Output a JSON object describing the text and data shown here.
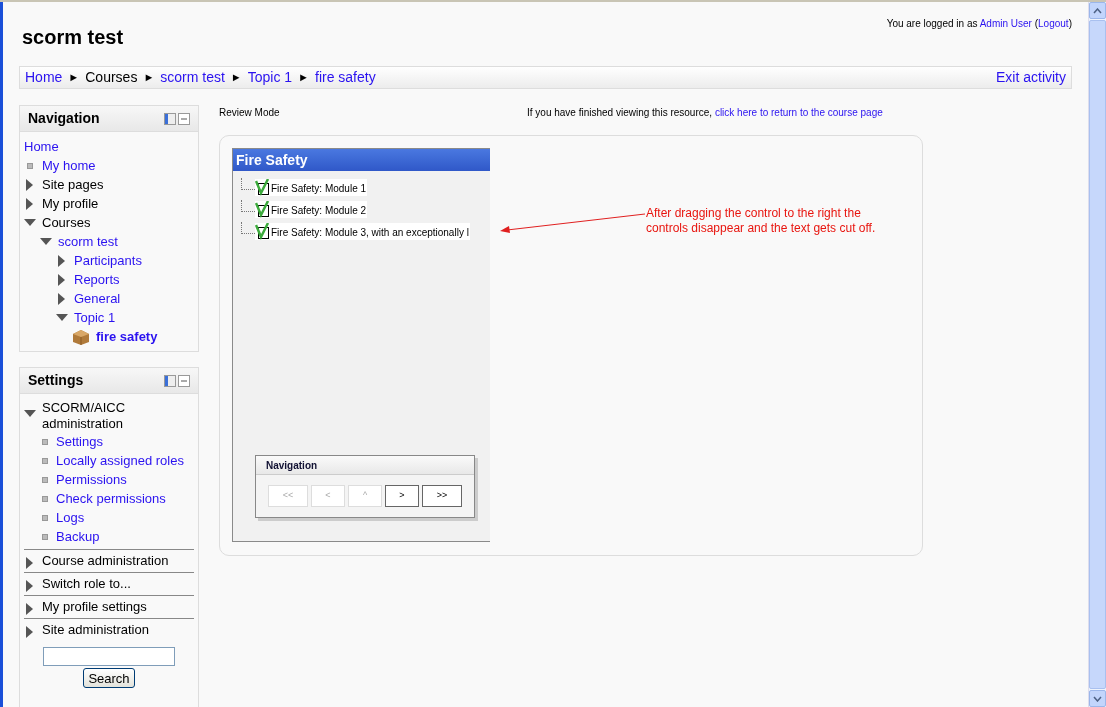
{
  "header": {
    "title": "scorm test",
    "login_text": "You are logged in as",
    "user": "Admin User",
    "logout_open": "(",
    "logout": "Logout",
    "logout_close": ")"
  },
  "breadcrumb": {
    "separator": "►",
    "items": [
      {
        "label": "Home",
        "link": true
      },
      {
        "label": "Courses",
        "link": false
      },
      {
        "label": "scorm test",
        "link": true
      },
      {
        "label": "Topic 1",
        "link": true
      },
      {
        "label": "fire safety",
        "link": true
      }
    ],
    "exit": "Exit activity"
  },
  "navigation": {
    "title": "Navigation",
    "items": [
      {
        "label": "Home",
        "kind": "root",
        "link": true
      },
      {
        "label": "My home",
        "kind": "leaf",
        "link": true
      },
      {
        "label": "Site pages",
        "kind": "branch",
        "link": false,
        "expanded": false
      },
      {
        "label": "My profile",
        "kind": "branch",
        "link": false,
        "expanded": false
      },
      {
        "label": "Courses",
        "kind": "branch",
        "link": false,
        "expanded": true,
        "children": [
          {
            "label": "scorm test",
            "kind": "branch",
            "link": true,
            "expanded": true,
            "children": [
              {
                "label": "Participants",
                "kind": "branch",
                "link": true,
                "expanded": false
              },
              {
                "label": "Reports",
                "kind": "branch",
                "link": true,
                "expanded": false
              },
              {
                "label": "General",
                "kind": "branch",
                "link": true,
                "expanded": false
              },
              {
                "label": "Topic 1",
                "kind": "branch",
                "link": true,
                "expanded": true,
                "children": [
                  {
                    "label": "fire safety",
                    "kind": "activity",
                    "link": true
                  }
                ]
              }
            ]
          }
        ]
      }
    ]
  },
  "settings": {
    "title": "Settings",
    "sections": [
      {
        "label": "SCORM/AICC administration",
        "expanded": true,
        "children": [
          {
            "label": "Settings"
          },
          {
            "label": "Locally assigned roles"
          },
          {
            "label": "Permissions"
          },
          {
            "label": "Check permissions"
          },
          {
            "label": "Logs"
          },
          {
            "label": "Backup"
          }
        ]
      },
      {
        "label": "Course administration",
        "expanded": false
      },
      {
        "label": "Switch role to...",
        "expanded": false
      },
      {
        "label": "My profile settings",
        "expanded": false
      },
      {
        "label": "Site administration",
        "expanded": false
      }
    ],
    "search_button": "Search"
  },
  "main": {
    "review_mode": "Review Mode",
    "return_text": "If you have finished viewing this resource,",
    "return_link": "click here to return to the course page"
  },
  "player": {
    "title": "Fire Safety",
    "modules": [
      {
        "label": "Fire Safety: Module 1",
        "completed": true
      },
      {
        "label": "Fire Safety: Module 2",
        "completed": true
      },
      {
        "label": "Fire Safety: Module 3, with an exceptionally l",
        "completed": true
      }
    ],
    "nav_title": "Navigation",
    "nav_buttons": [
      {
        "label": "<<",
        "disabled": true
      },
      {
        "label": "<",
        "disabled": true
      },
      {
        "label": "^",
        "disabled": true
      },
      {
        "label": ">",
        "disabled": false
      },
      {
        "label": ">>",
        "disabled": false
      }
    ]
  },
  "annotation": {
    "lines": [
      "After dragging the control to the right the",
      "controls disappear and the text gets cut off."
    ]
  }
}
